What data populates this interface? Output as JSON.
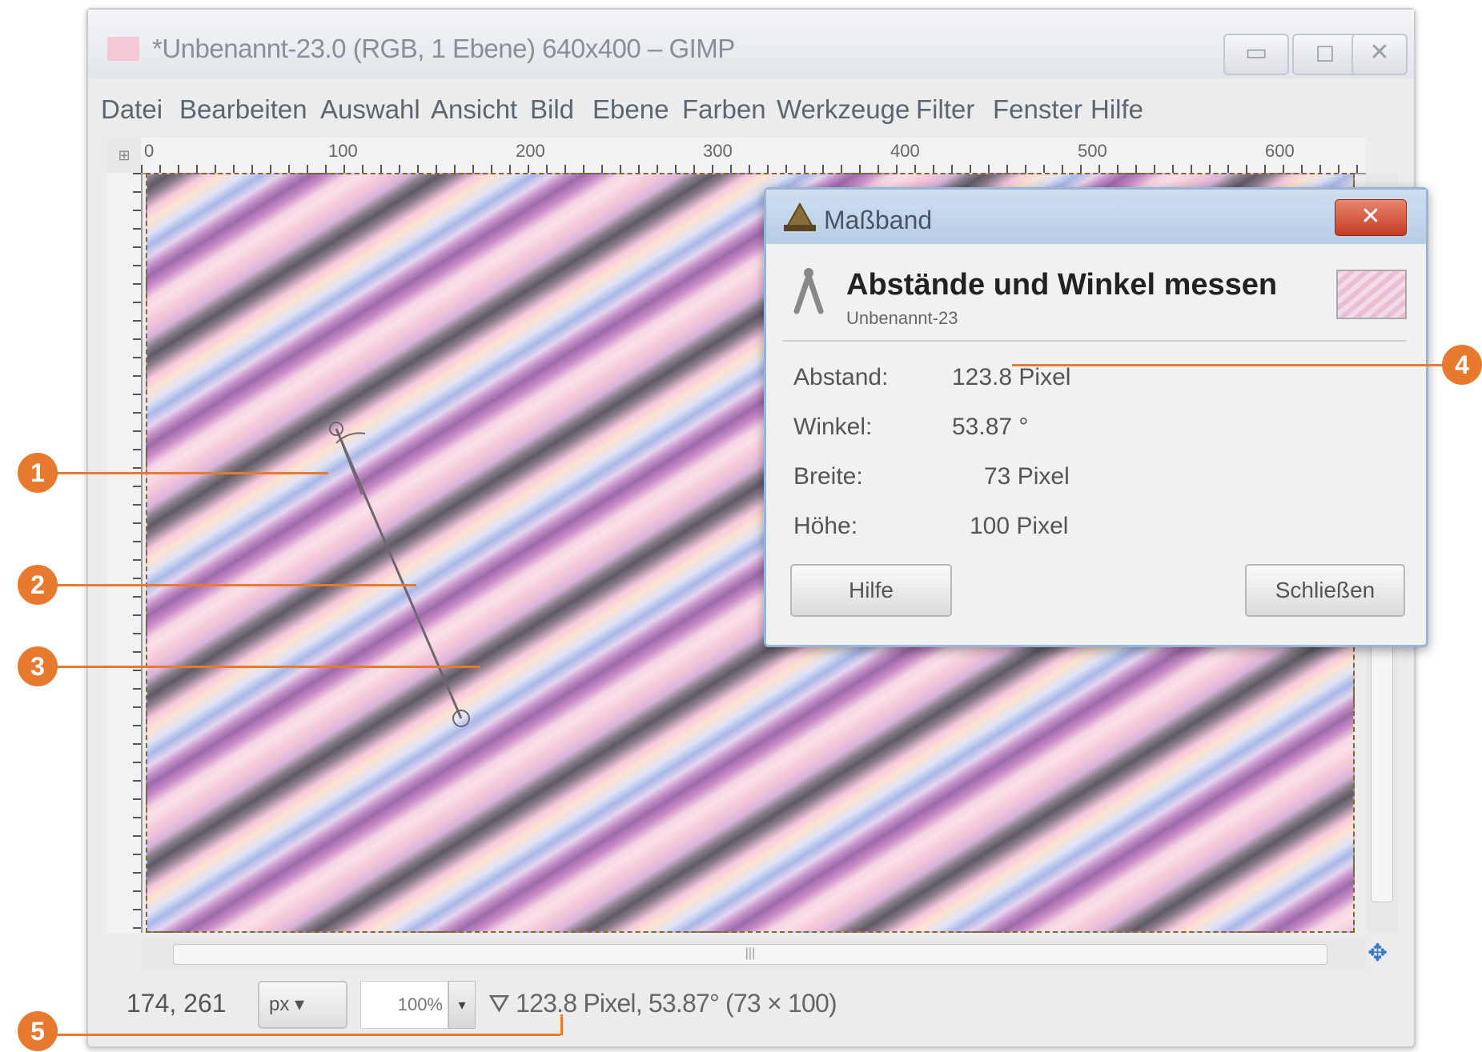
{
  "window": {
    "title": "*Unbenannt-23.0 (RGB, 1 Ebene) 640x400 – GIMP",
    "minimize": "▭",
    "maximize": "◻",
    "close": "✕"
  },
  "menu": [
    "Datei",
    "Bearbeiten",
    "Auswahl",
    "Ansicht",
    "Bild",
    "Ebene",
    "Farben",
    "Werkzeuge",
    "Filter",
    "Fenster",
    "Hilfe"
  ],
  "ruler": {
    "top_ticks": [
      "0",
      "100",
      "200",
      "300",
      "400",
      "500",
      "600"
    ],
    "corner": "⊞"
  },
  "statusbar": {
    "coordinates": "174, 261",
    "unit": "px ▾",
    "zoom": "100%",
    "zoom_drop": "▾",
    "message": "⛛ 123.8 Pixel, 53.87° (73 × 100)"
  },
  "dialog": {
    "title": "Maßband",
    "close": "✕",
    "heading": "Abstände und Winkel messen",
    "subheading": "Unbenannt-23",
    "rows": [
      {
        "label": "Abstand:",
        "value": "123.8 Pixel"
      },
      {
        "label": "Winkel:",
        "value": "53.87 °"
      },
      {
        "label": "Breite:",
        "value": "73 Pixel"
      },
      {
        "label": "Höhe:",
        "value": "100 Pixel"
      }
    ],
    "help_button": "Hilfe",
    "close_button": "Schließen"
  },
  "callouts": [
    "1",
    "2",
    "3",
    "4",
    "5"
  ],
  "colors": {
    "accent": "#e87a2f",
    "dialog_border": "#9ab4d6",
    "close_red": "#c43b22"
  }
}
